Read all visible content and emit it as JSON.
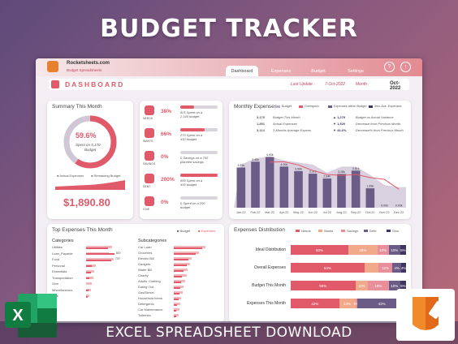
{
  "banner": {
    "title": "BUDGET TRACKER"
  },
  "footer": {
    "text": "EXCEL SPREADSHEET DOWNLOAD"
  },
  "app": {
    "brand": "Rocketsheets.com",
    "brand_sub": "Budget Spreadsheets",
    "tabs": [
      "Dashboard",
      "Expenses",
      "Budget",
      "Settings"
    ],
    "help_icon": "?",
    "up_icon": "↑"
  },
  "dashbar": {
    "title": "DASHBOARD",
    "last_update_label": "Last Update :",
    "last_update_value": "7-Oct-2022",
    "month_label": "Month :",
    "month_value": "Oct-2022"
  },
  "summary": {
    "title": "Summary This Month",
    "percent": "59.6%",
    "line1": "Spent on 5,170",
    "line2": "Budget",
    "percent_value": 59.6,
    "legend_actual": "Actual Expenses",
    "legend_remaining": "Remaining Budget",
    "amount": "$1,890.80"
  },
  "kpis": [
    {
      "label": "NEEDS",
      "pct": "38%",
      "fill": 0.38,
      "line1": "821 Spent on a",
      "line2": "2,140 budget"
    },
    {
      "label": "WANTS",
      "pct": "66%",
      "fill": 0.66,
      "line1": "270 Spent on a",
      "line2": "410 budget"
    },
    {
      "label": "SAVINGS",
      "pct": "0%",
      "fill": 0.0,
      "line1": "0 Savings on a 700",
      "line2": "planned savings"
    },
    {
      "label": "DEBT",
      "pct": "200%",
      "fill": 1.0,
      "line1": "800 Spent on a",
      "line2": "400 budget"
    },
    {
      "label": "GIVE",
      "pct": "0%",
      "fill": 0.0,
      "line1": "0 Spent on a 200",
      "line2": "budget"
    }
  ],
  "monthly": {
    "title": "Monthly Expenses",
    "legend": [
      "Budget",
      "Overspent",
      "Expenses within Budget",
      "3mo Ave. Expenses"
    ],
    "stats": [
      {
        "value": "3,170",
        "label": "Budget This Month"
      },
      {
        "value": "1,891",
        "label": "Actual Expenses"
      },
      {
        "value": "3,114",
        "label": "3-Months Average Expens"
      }
    ],
    "stats_right": [
      {
        "value": "▲ 1,279",
        "label": "Budget vs Actual Variance"
      },
      {
        "value": "▼ 1,520",
        "label": "Decrease from Previous Month"
      },
      {
        "value": "▼ 44.6%",
        "label": "Decrease% from Previous Month"
      }
    ]
  },
  "top_expenses": {
    "title": "Top Expenses This Month",
    "legend": [
      "Budget",
      "Expenses"
    ],
    "categories_title": "Categories",
    "categories": [
      {
        "name": "Utilities",
        "value": "",
        "budget": 0.58,
        "actual": 0.48
      },
      {
        "name": "Loan_Payable",
        "value": "800",
        "budget": 0.5,
        "actual": 0.62
      },
      {
        "name": "Food",
        "value": "720",
        "budget": 0.6,
        "actual": 0.56
      },
      {
        "name": "Personal",
        "value": "",
        "budget": 0.22,
        "actual": 0.12
      },
      {
        "name": "Essentials",
        "value": "",
        "budget": 0.18,
        "actual": 0.1
      },
      {
        "name": "Transportation",
        "value": "",
        "budget": 0.16,
        "actual": 0.08
      },
      {
        "name": "Give",
        "value": "",
        "budget": 0.12,
        "actual": 0.0
      },
      {
        "name": "Miscellaneous",
        "value": "",
        "budget": 0.1,
        "actual": 0.05
      },
      {
        "name": "Kids",
        "value": "",
        "budget": 0.08,
        "actual": 0.04
      }
    ],
    "subcategories_title": "Subcategories",
    "subcategories": [
      {
        "name": "Car Loan",
        "budget": 0.7,
        "actual": 0.62
      },
      {
        "name": "Groceries",
        "budget": 0.55,
        "actual": 0.48
      },
      {
        "name": "Electric Bill",
        "budget": 0.4,
        "actual": 0.32
      },
      {
        "name": "Gadgets",
        "budget": 0.35,
        "actual": 0.28
      },
      {
        "name": "Water Bill",
        "budget": 0.3,
        "actual": 0.22
      },
      {
        "name": "Charity",
        "budget": 0.28,
        "actual": 0.18
      },
      {
        "name": "Adults' Clothing",
        "budget": 0.25,
        "actual": 0.16
      },
      {
        "name": "Eating Out",
        "budget": 0.22,
        "actual": 0.14
      },
      {
        "name": "Gas/Diesel",
        "budget": 0.2,
        "actual": 0.12
      },
      {
        "name": "Household Items",
        "budget": 0.16,
        "actual": 0.1
      },
      {
        "name": "Detergents",
        "budget": 0.14,
        "actual": 0.08
      },
      {
        "name": "Car Maintenance",
        "budget": 0.12,
        "actual": 0.06
      },
      {
        "name": "Toiletries",
        "budget": 0.1,
        "actual": 0.05
      }
    ]
  },
  "distribution": {
    "title": "Expenses Distribution",
    "legend": [
      "Needs",
      "Wants",
      "Savings",
      "Debt",
      "Give"
    ],
    "colors": [
      "#e05a6a",
      "#f2a98a",
      "#e88f9a",
      "#6a5c86",
      "#3f3560"
    ],
    "rows": [
      {
        "label": "Ideal Distribution",
        "segs": [
          50,
          25,
          10,
          10,
          5
        ],
        "texts": [
          "50%",
          "25%",
          "10%",
          "10%",
          "5%"
        ]
      },
      {
        "label": "Overall Expenses",
        "segs": [
          64,
          12,
          12,
          8,
          4
        ],
        "texts": [
          "64%",
          "",
          "12%",
          "4%",
          "4%"
        ]
      },
      {
        "label": "Budget This Month",
        "segs": [
          56,
          11,
          18,
          10,
          5
        ],
        "texts": [
          "56%",
          "11%",
          "18%",
          "10%",
          "5%"
        ]
      },
      {
        "label": "Expenses This Month",
        "segs": [
          42,
          14,
          2,
          42,
          0
        ],
        "texts": [
          "42%",
          "14%",
          "0%",
          "42%",
          ""
        ]
      }
    ]
  },
  "chart_data": {
    "type": "bar",
    "categories": [
      "Jan-22",
      "Feb-22",
      "Mar-22",
      "Apr-22",
      "May-22",
      "Jun-22",
      "Jul-22",
      "Aug-22",
      "Sep-22",
      "Oct-22",
      "Nov-22",
      "Dec-22"
    ],
    "series": [
      {
        "name": "Budget",
        "values": [
          4.2,
          4.8,
          5.0,
          4.6,
          4.4,
          4.2,
          3.4,
          4.0,
          4.0,
          3.2,
          2.2,
          2.0
        ]
      },
      {
        "name": "Expenses within Budget",
        "values": [
          3.91,
          4.48,
          4.93,
          4.0,
          3.56,
          3.31,
          2.84,
          3.28,
          3.61,
          1.89,
          0,
          0
        ]
      },
      {
        "name": "3mo Ave. Expenses",
        "values": [
          null,
          null,
          4.44,
          4.47,
          4.16,
          3.62,
          3.24,
          3.14,
          3.24,
          2.93,
          2.75,
          1.8
        ]
      }
    ],
    "data_labels": [
      "3.91k",
      "4.48k",
      "4.93k",
      "4.00k",
      "3.56k",
      "3.31k",
      "2.84k",
      "3.28k",
      "3.61k",
      "1.89k",
      "0.00k",
      "0.00k"
    ],
    "title": "Monthly Expenses",
    "ylim": [
      0,
      6
    ]
  }
}
